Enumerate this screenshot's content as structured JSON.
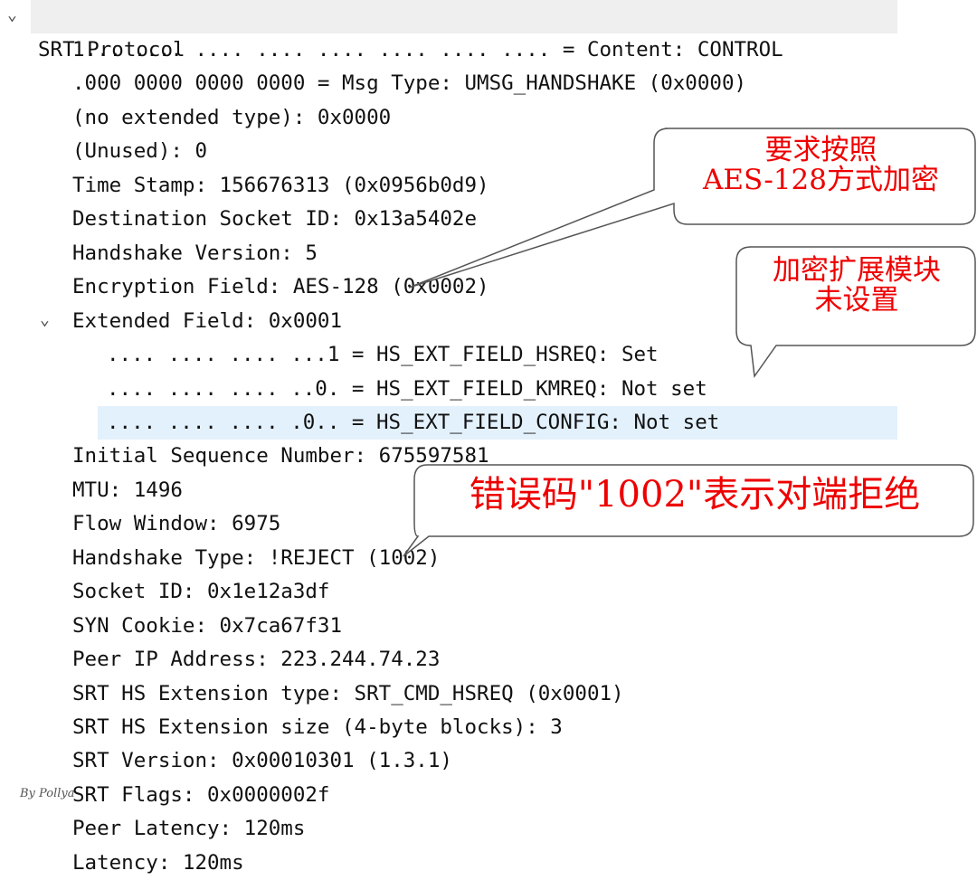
{
  "tree": {
    "header": "SRT Protocol",
    "rows": [
      "1... .... .... .... .... .... .... .... = Content: CONTROL",
      ".000 0000 0000 0000 = Msg Type: UMSG_HANDSHAKE (0x0000)",
      "(no extended type): 0x0000",
      "(Unused): 0",
      "Time Stamp: 156676313 (0x0956b0d9)",
      "Destination Socket ID: 0x13a5402e",
      "Handshake Version: 5",
      "Encryption Field: AES-128 (0x0002)",
      "Extended Field: 0x0001",
      ".... .... .... ...1 = HS_EXT_FIELD_HSREQ: Set",
      ".... .... .... ..0. = HS_EXT_FIELD_KMREQ: Not set",
      ".... .... .... .0.. = HS_EXT_FIELD_CONFIG: Not set",
      "Initial Sequence Number: 675597581",
      "MTU: 1496",
      "Flow Window: 6975",
      "Handshake Type: !REJECT (1002)",
      "Socket ID: 0x1e12a3df",
      "SYN Cookie: 0x7ca67f31",
      "Peer IP Address: 223.244.74.23",
      "SRT HS Extension type: SRT_CMD_HSREQ (0x0001)",
      "SRT HS Extension size (4-byte blocks): 3",
      "SRT Version: 0x00010301 (1.3.1)",
      "SRT Flags: 0x0000002f",
      "Peer Latency: 120ms",
      "Latency: 120ms"
    ]
  },
  "callouts": {
    "encryption": "要求按照\nAES-128方式加密",
    "kmreq": "加密扩展模块\n未设置",
    "reject": "错误码\"1002\"表示对端拒绝"
  },
  "signature": "By Pollya",
  "colors": {
    "annotation": "#ee0000",
    "selected_row": "#e3f1fc",
    "header_row": "#efefef"
  }
}
